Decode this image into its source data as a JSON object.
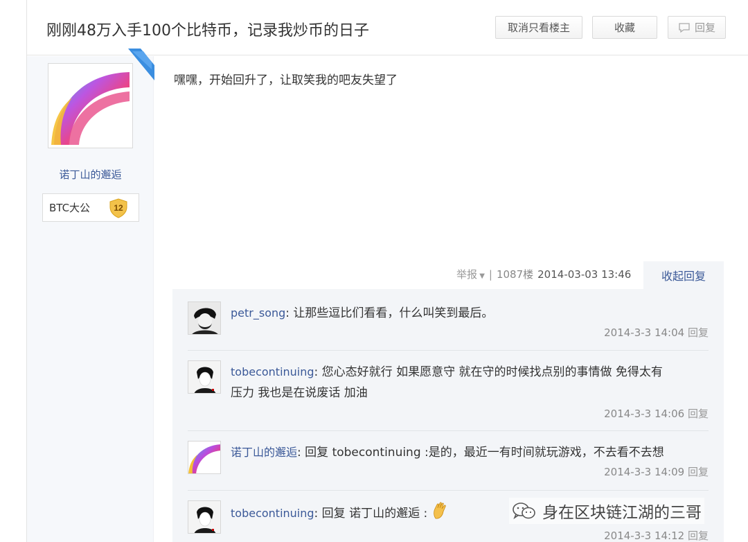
{
  "header": {
    "title": "刚刚48万入手100个比特币，记录我炒币的日子",
    "btn_only_op": "取消只看楼主",
    "btn_favorite": "收藏",
    "btn_reply": "回复"
  },
  "author": {
    "name": "诺丁山的邂逅",
    "badge_label": "BTC大公",
    "level": "12"
  },
  "post": {
    "content": "嘿嘿，开始回升了，让取笑我的吧友失望了",
    "report": "举报",
    "floor": "1087楼",
    "time": "2014-03-03 13:46",
    "collapse": "收起回复"
  },
  "replies": [
    {
      "user": "petr_song",
      "text": ": 让那些逗比们看看，什么叫笑到最后。",
      "time": "2014-3-3 14:04",
      "reply": "回复"
    },
    {
      "user": "tobecontinuing",
      "text_line1": ": 您心态好就行 如果愿意守 就在守的时候找点别的事情做 免得太有",
      "text_line2": "压力 我也是在说废话 加油",
      "time": "2014-3-3 14:06",
      "reply": "回复"
    },
    {
      "user": "诺丁山的邂逅",
      "text_prefix": ": 回复 ",
      "target": "tobecontinuing",
      "text_suffix": " :是的，最近一有时间就玩游戏，不去看不去想",
      "time": "2014-3-3 14:09",
      "reply": "回复"
    },
    {
      "user": "tobecontinuing",
      "text_prefix": ": 回复 ",
      "target": "诺丁山的邂逅",
      "text_suffix": " :",
      "time": "2014-3-3 14:12",
      "reply": "回复"
    }
  ],
  "watermark": "身在区块链江湖的三哥",
  "colors": {
    "link": "#3b5998",
    "accent_ribbon": "#3b8ee0",
    "badge_gold": "#f3c24a"
  }
}
